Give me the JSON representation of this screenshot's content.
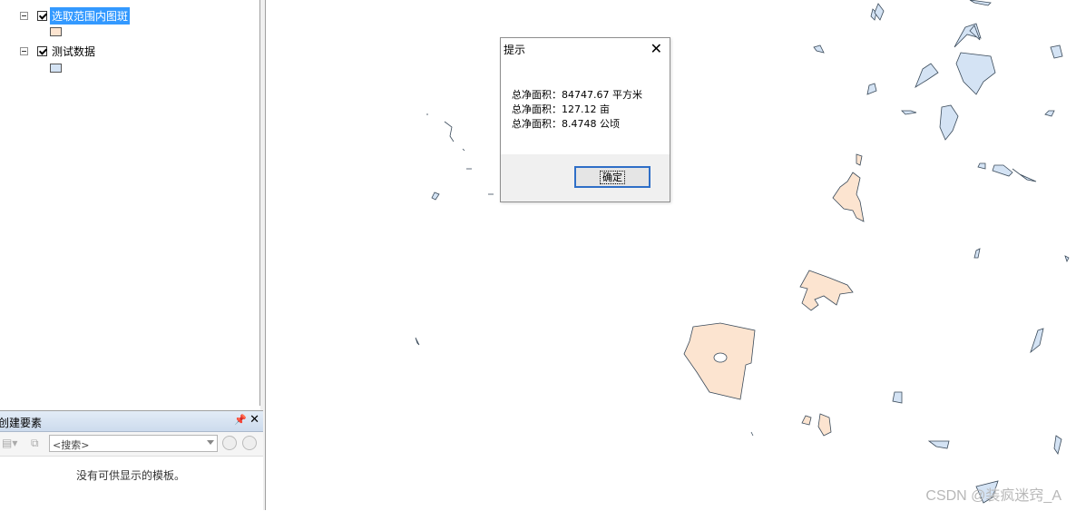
{
  "toc": {
    "layers": [
      {
        "name": "选取范围内图斑",
        "checked": true,
        "selected": true,
        "swatch_color": "#fce4d0"
      },
      {
        "name": "测试数据",
        "checked": true,
        "selected": false,
        "swatch_color": "#d4e3f4"
      }
    ]
  },
  "create_features": {
    "title": "创建要素",
    "pin_icon": "pin-icon",
    "close_symbol": "✕",
    "search_placeholder": "<搜索>",
    "empty_message": "没有可供显示的模板。"
  },
  "dialog": {
    "title": "提示",
    "close_symbol": "✕",
    "lines": [
      "总净面积：84747.67 平方米",
      "总净面积：127.12 亩",
      "总净面积：8.4748 公顷"
    ],
    "ok_label": "确定"
  },
  "map": {
    "selected_fill": "#fce4d0",
    "test_fill": "#d4e3f4",
    "outline": "#3a4a5a"
  },
  "watermark": "CSDN @装疯迷窍_A"
}
